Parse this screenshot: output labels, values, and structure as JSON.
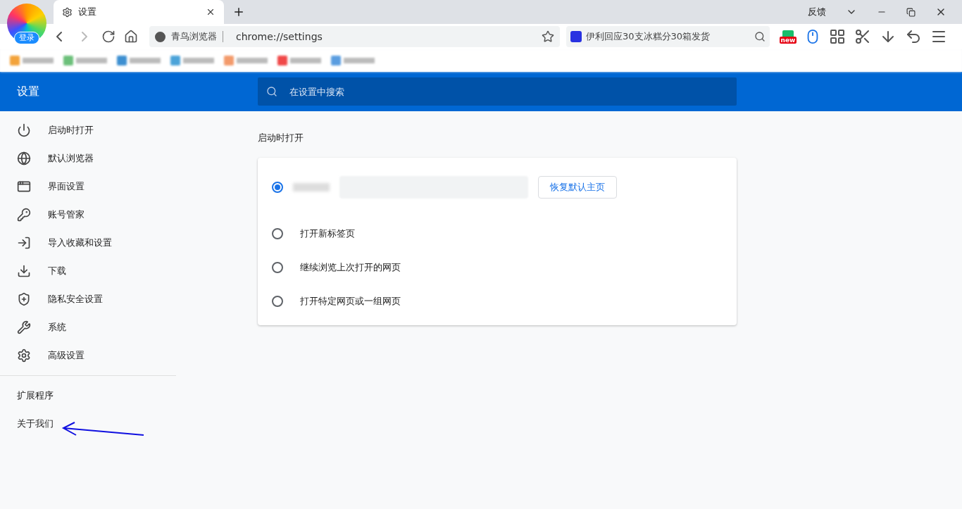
{
  "browser": {
    "login_label": "登录",
    "tab": {
      "title": "设置"
    },
    "feedback": "反馈",
    "address": {
      "site_name": "青鸟浏览器",
      "url": "chrome://settings"
    },
    "search": {
      "value": "伊利回应30支冰糕分30箱发货"
    },
    "new_badge": "new"
  },
  "header": {
    "title": "设置",
    "search": {
      "placeholder": "在设置中搜索"
    }
  },
  "sidebar": {
    "items": [
      {
        "label": "启动时打开"
      },
      {
        "label": "默认浏览器"
      },
      {
        "label": "界面设置"
      },
      {
        "label": "账号管家"
      },
      {
        "label": "导入收藏和设置"
      },
      {
        "label": "下载"
      },
      {
        "label": "隐私安全设置"
      },
      {
        "label": "系统"
      },
      {
        "label": "高级设置"
      }
    ],
    "links": [
      "扩展程序",
      "关于我们"
    ]
  },
  "startup": {
    "heading": "启动时打开",
    "options": [
      {
        "kind": "homepage",
        "selected": true,
        "button": "恢复默认主页"
      },
      {
        "kind": "plain",
        "selected": false,
        "label": "打开新标签页"
      },
      {
        "kind": "plain",
        "selected": false,
        "label": "继续浏览上次打开的网页"
      },
      {
        "kind": "plain",
        "selected": false,
        "label": "打开特定网页或一组网页"
      }
    ]
  }
}
